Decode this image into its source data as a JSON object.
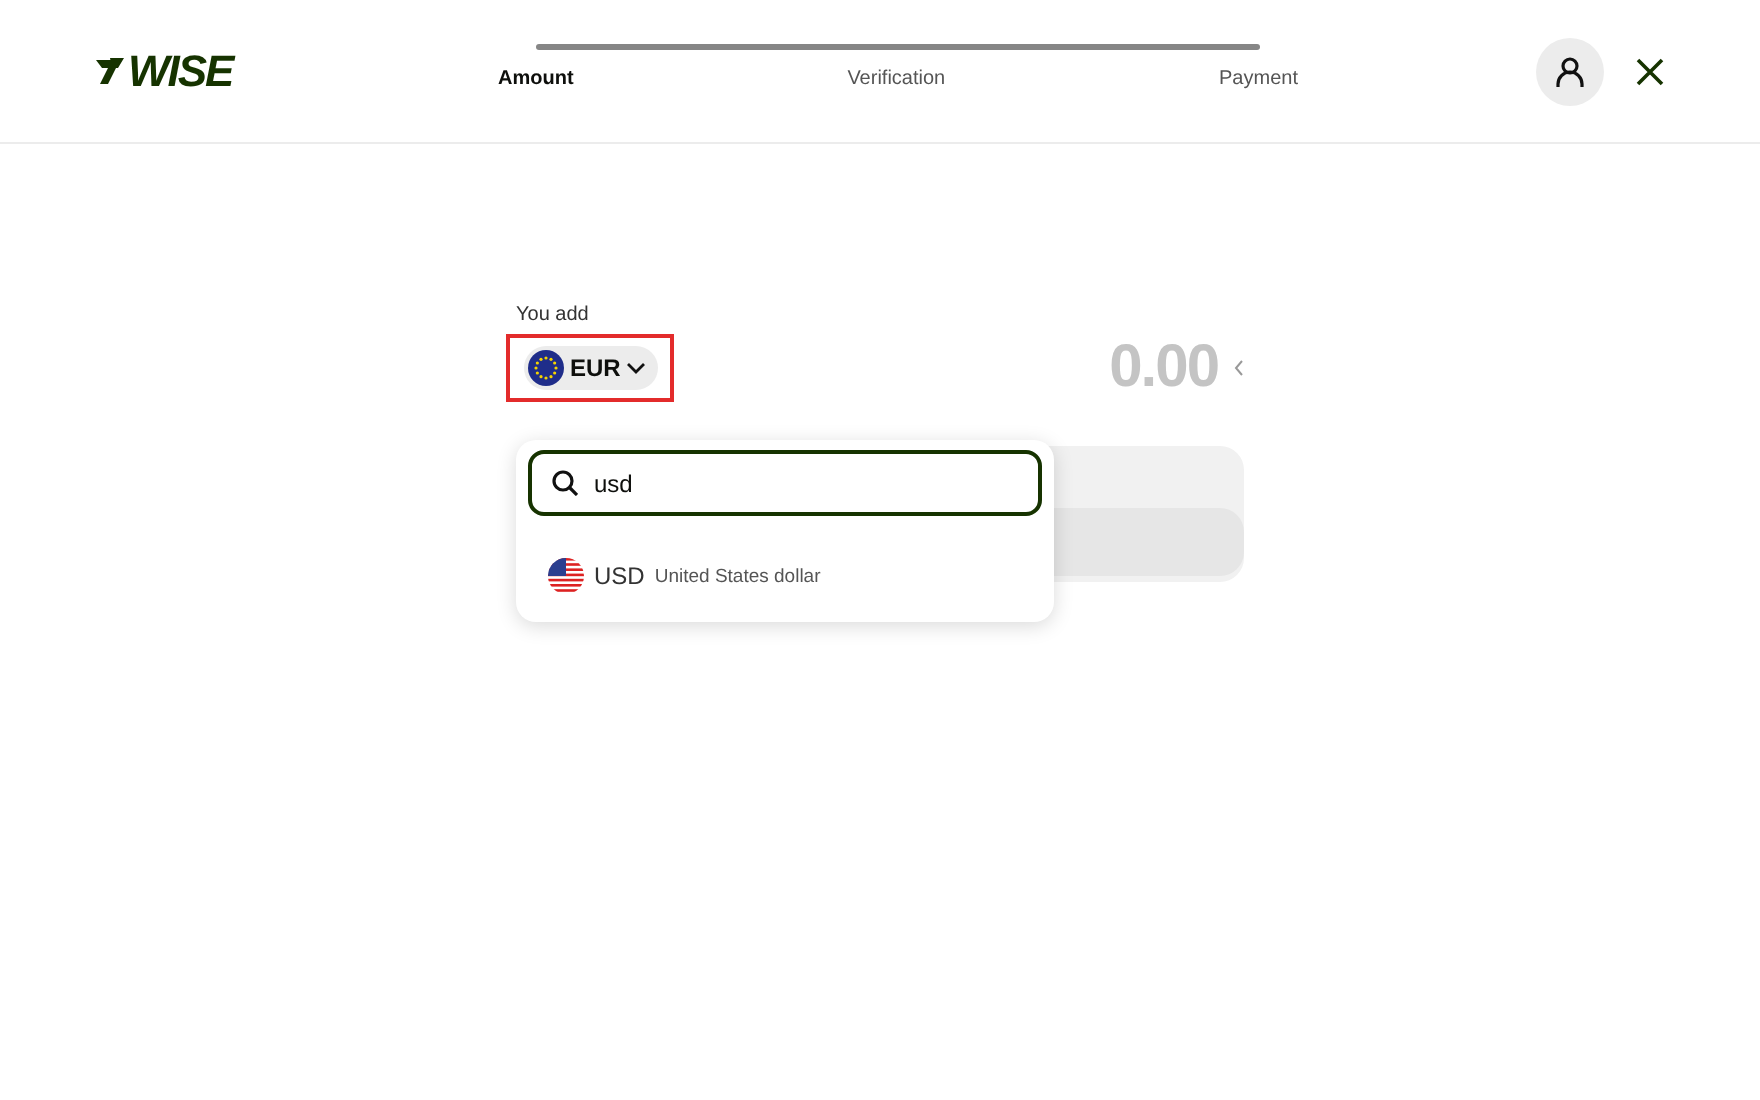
{
  "header": {
    "logo": "WISE",
    "steps": [
      {
        "label": "Amount",
        "selected": true
      },
      {
        "label": "Verification",
        "selected": false
      },
      {
        "label": "Payment",
        "selected": false
      }
    ]
  },
  "form": {
    "label": "You add",
    "currency": {
      "code": "EUR",
      "highlighted": true
    },
    "amount": "0.00"
  },
  "dropdown": {
    "search": {
      "value": "usd"
    },
    "results": [
      {
        "code": "USD",
        "name": "United States dollar"
      }
    ]
  }
}
